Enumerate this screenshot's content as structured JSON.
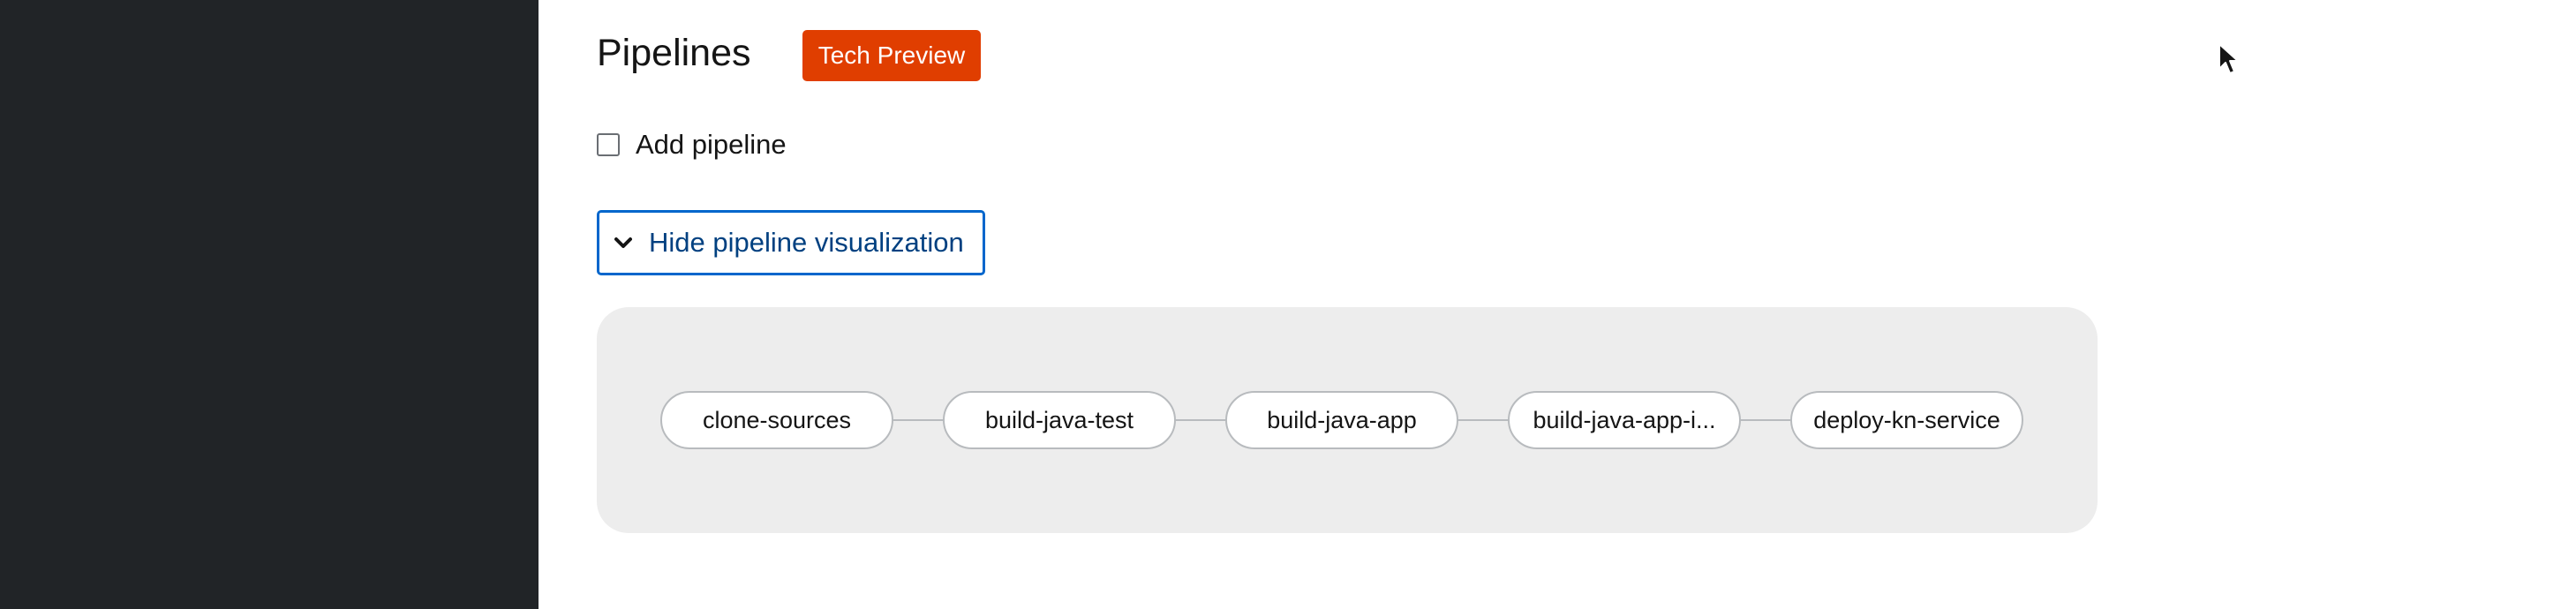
{
  "header": {
    "title": "Pipelines",
    "badge": "Tech Preview",
    "badge_color": "#e03e00"
  },
  "add_pipeline": {
    "label": "Add pipeline",
    "checked": false
  },
  "visualization_toggle": {
    "label": "Hide pipeline visualization",
    "icon": "chevron-down-icon",
    "accent_color": "#0066cc"
  },
  "pipeline": {
    "tasks": [
      {
        "name": "clone-sources"
      },
      {
        "name": "build-java-test"
      },
      {
        "name": "build-java-app"
      },
      {
        "name": "build-java-app-i..."
      },
      {
        "name": "deploy-kn-service"
      }
    ]
  }
}
